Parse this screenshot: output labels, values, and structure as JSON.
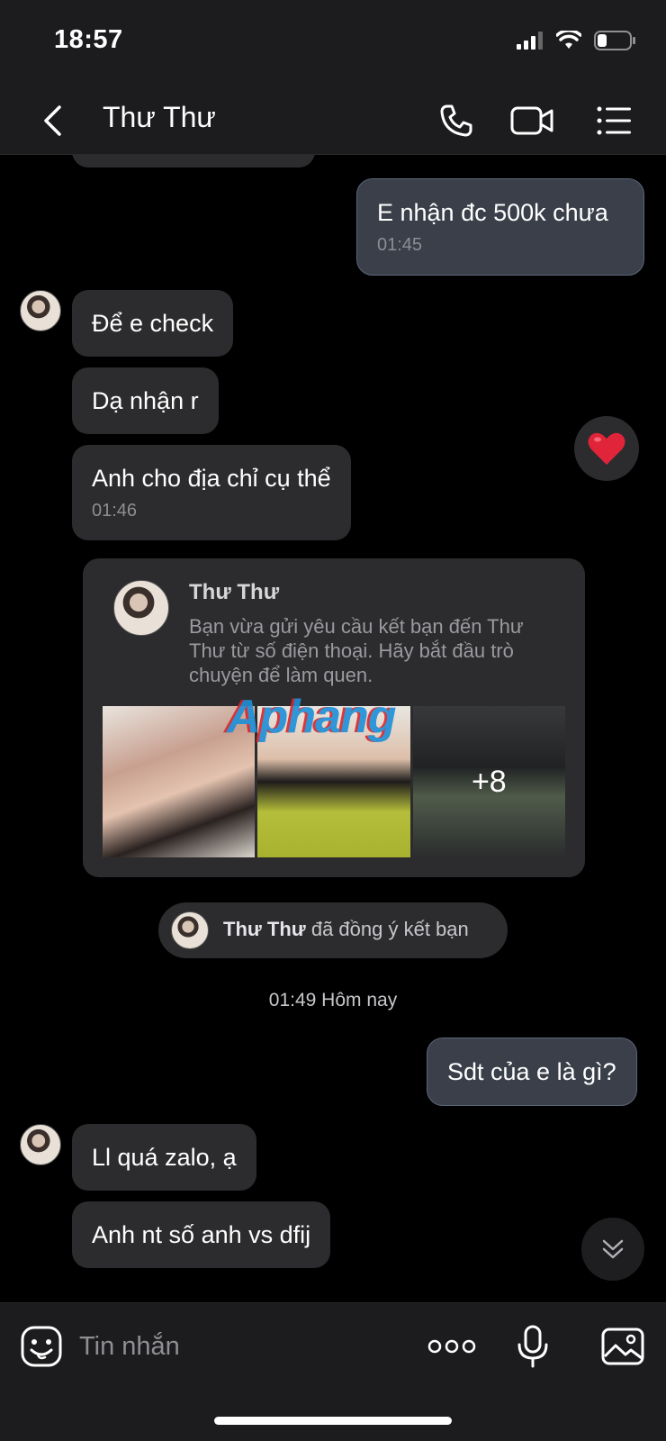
{
  "status": {
    "time": "18:57"
  },
  "header": {
    "title": "Thư Thư",
    "icons": [
      "back-icon",
      "phone-icon",
      "video-icon",
      "menu-icon"
    ]
  },
  "messages": {
    "out1": {
      "text": "E nhận đc 500k chưa",
      "time": "01:45"
    },
    "in1": {
      "text": "Để e check"
    },
    "in2": {
      "text": "Dạ nhận r"
    },
    "in3": {
      "text": "Anh cho địa chỉ cụ thể",
      "time": "01:46"
    },
    "reaction": "heart",
    "out2": {
      "text": "Sdt của e là gì?"
    },
    "in4": {
      "text": "Ll quá zalo, ạ"
    },
    "in5": {
      "text": "Anh nt số anh vs dfij"
    }
  },
  "friend_card": {
    "name": "Thư Thư",
    "description": "Bạn vừa gửi yêu cầu kết bạn đến Thư Thư từ số điện thoại. Hãy bắt đầu trò chuyện để làm quen.",
    "more_photos": "+8",
    "watermark": "Aphang"
  },
  "system": {
    "name": "Thư Thư",
    "text": " đã đồng ý kết bạn",
    "day_label": "01:49 Hôm nay"
  },
  "input": {
    "placeholder": "Tin nhắn"
  },
  "colors": {
    "background": "#000000",
    "bar": "#1c1c1e",
    "bubble_in": "#2c2c2e",
    "bubble_out": "#3a3f4a",
    "heart": "#e0243a"
  }
}
